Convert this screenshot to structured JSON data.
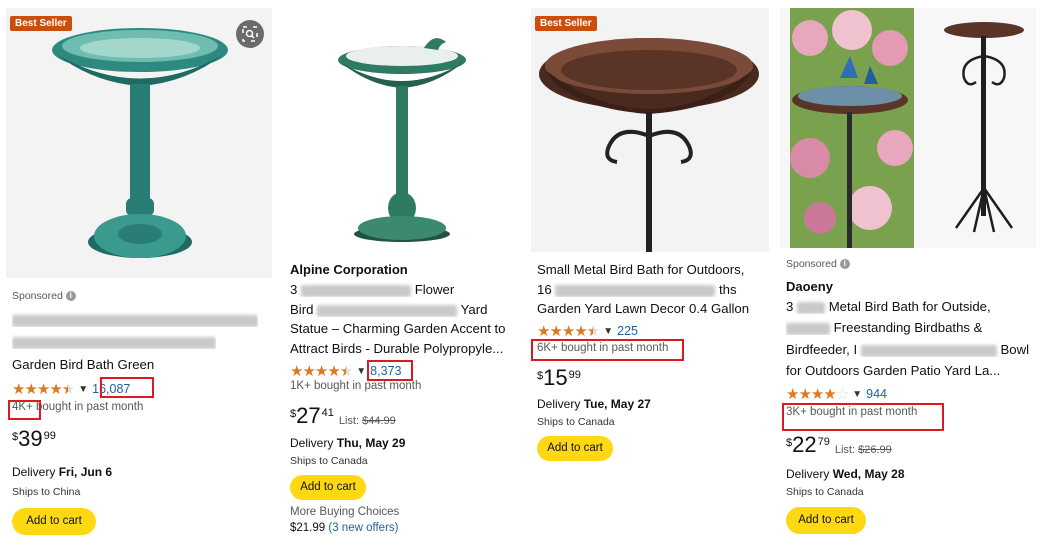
{
  "cards": [
    {
      "badge": "Best Seller",
      "sponsored": "Sponsored",
      "brand": "",
      "title_lines": [
        "Garden Bird Bath Green"
      ],
      "rating_count": "16,087",
      "bought": "4K+ bought in past month",
      "bought_prefix": "4K+",
      "bought_suffix": " bought in past month",
      "price": {
        "symbol": "$",
        "whole": "39",
        "fraction": "99"
      },
      "list_price": "",
      "delivery_prefix": "Delivery ",
      "delivery_date": "Fri, Jun 6",
      "ships": "Ships to China",
      "add_to_cart": "Add to cart",
      "stars": 4.5
    },
    {
      "badge": "",
      "sponsored": "",
      "brand": "Alpine Corporation",
      "title_lines": [
        "3",
        "Flower",
        "Bird",
        "Yard",
        "Statue – Charming Garden Accent to",
        "Attract Birds - Durable Polypropyle..."
      ],
      "rating_count": "8,373",
      "bought": "1K+ bought in past month",
      "price": {
        "symbol": "$",
        "whole": "27",
        "fraction": "41"
      },
      "list_label": "List: ",
      "list_price": "$44.99",
      "delivery_prefix": "Delivery ",
      "delivery_date": "Thu, May 29",
      "ships": "Ships to Canada",
      "add_to_cart": "Add to cart",
      "more_buying": "More Buying Choices",
      "more_price": "$21.99",
      "more_offers": "(3 new offers)",
      "stars": 4.5
    },
    {
      "badge": "Best Seller",
      "sponsored": "",
      "brand": "",
      "title_lines": [
        "Small Metal Bird Bath for Outdoors,",
        "16",
        "ths",
        "Garden Yard Lawn Decor 0.4 Gallon"
      ],
      "rating_count": "225",
      "bought": "6K+ bought in past month",
      "price": {
        "symbol": "$",
        "whole": "15",
        "fraction": "99"
      },
      "list_price": "",
      "delivery_prefix": "Delivery ",
      "delivery_date": "Tue, May 27",
      "ships": "Ships to Canada",
      "add_to_cart": "Add to cart",
      "stars": 4.5
    },
    {
      "badge": "",
      "sponsored": "Sponsored",
      "brand": "Daoeny",
      "title_lines": [
        "3",
        "Metal Bird Bath for Outside,",
        "Freestanding Birdbaths &",
        "Birdfeeder, I",
        "Bowl",
        "for Outdoors Garden Patio Yard La..."
      ],
      "rating_count": "944",
      "bought": "3K+ bought in past month",
      "price": {
        "symbol": "$",
        "whole": "22",
        "fraction": "79"
      },
      "list_label": "List: ",
      "list_price": "$26.99",
      "delivery_prefix": "Delivery ",
      "delivery_date": "Wed, May 28",
      "ships": "Ships to Canada",
      "add_to_cart": "Add to cart",
      "stars": 4.0
    }
  ],
  "icons": [
    "lens-icon",
    "star-icon",
    "chevron-down-icon",
    "info-icon"
  ],
  "colors": {
    "badge": "#cc4e0c",
    "star": "#de7921",
    "link": "#2162a1",
    "cart": "#ffd814",
    "highlight": "#e0191f"
  }
}
